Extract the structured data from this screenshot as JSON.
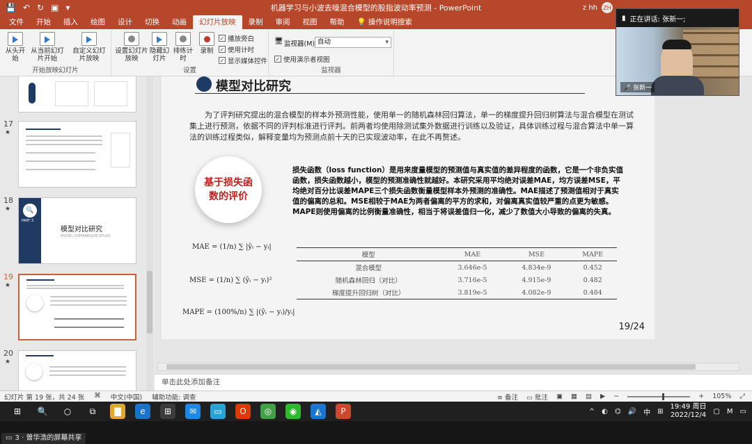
{
  "window": {
    "title": "机器学习与小波去噪混合模型的股指波动率预测  -  PowerPoint",
    "user": "z hh",
    "user_avatar": "ZH"
  },
  "ribbon_tabs": [
    {
      "label": "文件"
    },
    {
      "label": "开始"
    },
    {
      "label": "插入"
    },
    {
      "label": "绘图"
    },
    {
      "label": "设计"
    },
    {
      "label": "切换"
    },
    {
      "label": "动画"
    },
    {
      "label": "幻灯片放映"
    },
    {
      "label": "录制"
    },
    {
      "label": "审阅"
    },
    {
      "label": "视图"
    },
    {
      "label": "帮助"
    },
    {
      "label": "操作说明搜索"
    }
  ],
  "ribbon": {
    "group_start": {
      "label": "开始放映幻灯片",
      "from_start": "从头开始",
      "from_current": "从当前幻灯片开始",
      "custom": "自定义幻灯片放映"
    },
    "group_setup": {
      "label": "设置",
      "setup_show": "设置幻灯片放映",
      "hide_slide": "隐藏幻灯片",
      "rehearse": "排练计时",
      "record": "录制",
      "play_narration": "播放旁白",
      "use_timings": "使用计时",
      "show_media": "显示媒体控件"
    },
    "group_monitor": {
      "label": "监视器",
      "monitor_label": "监视器(M):",
      "monitor_value": "自动",
      "presenter_view": "使用演示者视图"
    }
  },
  "thumbnails": [
    {
      "num": "",
      "star": ""
    },
    {
      "num": "17",
      "star": "★"
    },
    {
      "num": "18",
      "star": "★",
      "title": "模型对比研究",
      "subtitle": "MODEL COMPARISON STUDY",
      "part": "PART 3"
    },
    {
      "num": "19",
      "star": "★"
    },
    {
      "num": "20",
      "star": "★"
    }
  ],
  "slide": {
    "title": "模型对比研究",
    "para1": "为了评判研究提出的混合模型的样本外预测性能，使用单一的随机森林回归算法，单一的梯度提升回归树算法与混合模型在测试集上进行预测，依据不同的评判标准进行评判。前两者均使用除测试集外数据进行训练以及验证，具体训练过程与混合算法中单一算法的训练过程类似，解释变量均为预测点前十天的已实现波动率，在此不再赘述。",
    "badge": "基于损失函数的评价",
    "para2": "损失函数（loss function）是用来度量模型的预测值与真实值的差异程度的函数，它是一个非负实值函数，损失函数越小，模型的预测准确性就越好。本研究采用平均绝对误差MAE，均方误差MSE，平均绝对百分比误差MAPE三个损失函数衡量模型样本外预测的准确性。MAE描述了预测值相对于真实值的偏离的总和。MSE相较于MAE为两者偏离的平方的求和，对偏离真实值较严重的点更为敏感。MAPE则使用偏离的比例衡量准确性，相当于将误差值归一化，减少了数值大小导致的偏离的失真。",
    "formulas": {
      "mae": "MAE = (1/n) ∑ |ŷᵢ − yᵢ|",
      "mse": "MSE = (1/n) ∑ (ŷᵢ − yᵢ)²",
      "mape": "MAPE = (100%/n) ∑ |(ŷᵢ − yᵢ)/yᵢ|"
    },
    "table": {
      "headers": [
        "模型",
        "MAE",
        "MSE",
        "MAPE"
      ],
      "rows": [
        [
          "混合模型",
          "3.646e-5",
          "4.834e-9",
          "0.452"
        ],
        [
          "随机森林回归（对比）",
          "3.716e-5",
          "4.915e-9",
          "0.482"
        ],
        [
          "梯度提升回归树（对比）",
          "3.819e-5",
          "4.082e-9",
          "0.484"
        ]
      ]
    },
    "page": "19/24"
  },
  "notes_placeholder": "单击此处添加备注",
  "status": {
    "slide_info": "幻灯片 第 19 张，共 24 张",
    "language": "中文(中国)",
    "accessibility": "辅助功能: 调查",
    "notes": "备注",
    "comments": "批注",
    "zoom": "105%"
  },
  "taskbar": {
    "time": "19:49 周日",
    "date": "2022/12/4",
    "ime": "中"
  },
  "share": {
    "label": "3 · 曾华浩的屏幕共享"
  },
  "video": {
    "speaking": "正在讲话: 张新一;",
    "name": "张新一"
  }
}
